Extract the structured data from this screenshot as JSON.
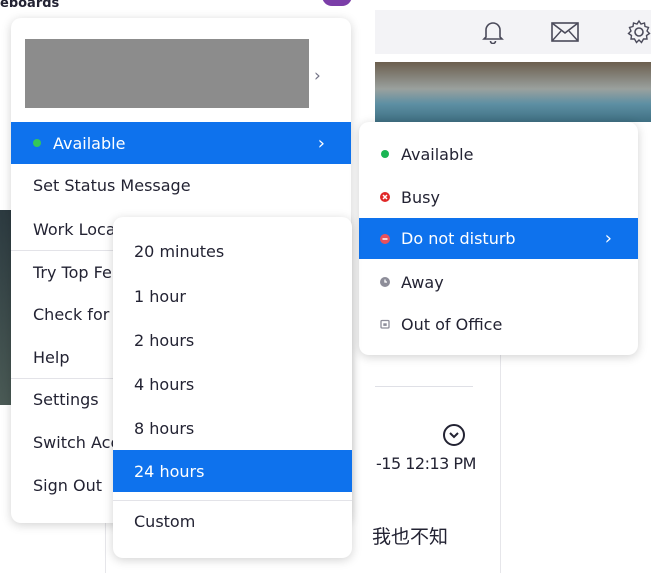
{
  "app": {
    "title": "eboards"
  },
  "background": {
    "timestamp": "-15 12:13 PM",
    "message_snippet": "我也不知"
  },
  "toolbar": {
    "icons": [
      "bell-icon",
      "mail-icon",
      "gear-icon"
    ]
  },
  "main_menu": {
    "profile_chevron": "›",
    "items": [
      {
        "label": "Available",
        "selected": true,
        "chevron": "›"
      },
      {
        "label": "Set Status Message"
      },
      {
        "label": "Work Loca"
      },
      {
        "label": "Try Top Fe"
      },
      {
        "label": "Check for"
      },
      {
        "label": "Help"
      },
      {
        "label": "Settings"
      },
      {
        "label": "Switch Acc"
      },
      {
        "label": "Sign Out"
      }
    ]
  },
  "status_menu": {
    "items": [
      {
        "label": "Available",
        "icon": "green-dot-icon",
        "color": "#1ab553"
      },
      {
        "label": "Busy",
        "icon": "red-x-icon",
        "color": "#e02828"
      },
      {
        "label": "Do not disturb",
        "icon": "red-dot-icon",
        "color": "#e8505b",
        "selected": true,
        "chevron": "›"
      },
      {
        "label": "Away",
        "icon": "clock-icon",
        "color": "#8d8d99"
      },
      {
        "label": "Out of Office",
        "icon": "calendar-icon",
        "color": "#8d8d99"
      }
    ]
  },
  "duration_menu": {
    "items": [
      {
        "label": "20 minutes"
      },
      {
        "label": "1 hour"
      },
      {
        "label": "2 hours"
      },
      {
        "label": "4 hours"
      },
      {
        "label": "8 hours"
      },
      {
        "label": "24 hours",
        "selected": true
      },
      {
        "label": "Custom"
      }
    ]
  },
  "colors": {
    "accent": "#0e72ed",
    "available": "#1ab553"
  }
}
